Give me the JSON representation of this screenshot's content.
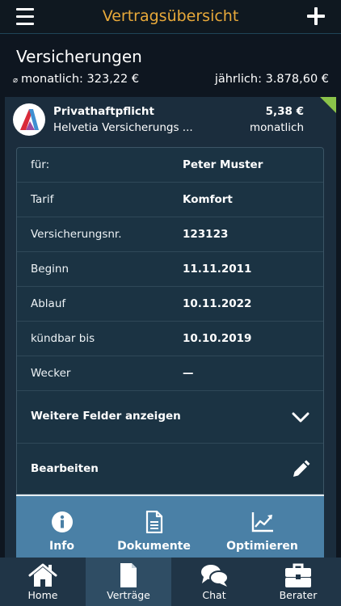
{
  "header": {
    "title": "Vertragsübersicht",
    "menu_icon": "hamburger-menu-icon",
    "add_icon": "plus-icon"
  },
  "section": {
    "title": "Versicherungen",
    "avg_symbol": "⌀",
    "monthly_label": "monatlich:",
    "monthly_value": "323,22 €",
    "yearly_label": "jährlich:",
    "yearly_value": "3.878,60 €"
  },
  "contract": {
    "name": "Privathaftpflicht",
    "company": "Helvetia Versicherungs ...",
    "amount": "5,38 €",
    "period": "monatlich",
    "logo_icon": "helvetia-logo-icon",
    "badge_color": "#8bc34a",
    "fields": [
      {
        "label": "für:",
        "value": "Peter Muster"
      },
      {
        "label": "Tarif",
        "value": "Komfort"
      },
      {
        "label": "Versicherungsnr.",
        "value": "123123"
      },
      {
        "label": "Beginn",
        "value": "11.11.2011"
      },
      {
        "label": "Ablauf",
        "value": "10.11.2022"
      },
      {
        "label": "kündbar bis",
        "value": "10.10.2019"
      },
      {
        "label": "Wecker",
        "value": "—"
      }
    ],
    "more_fields": "Weitere Felder anzeigen",
    "edit": "Bearbeiten",
    "tabs": [
      {
        "label": "Info",
        "icon": "info-icon"
      },
      {
        "label": "Dokumente",
        "icon": "document-icon"
      },
      {
        "label": "Optimieren",
        "icon": "chart-line-icon"
      }
    ]
  },
  "bottom_nav": [
    {
      "label": "Home",
      "icon": "home-icon",
      "active": false
    },
    {
      "label": "Verträge",
      "icon": "file-icon",
      "active": true
    },
    {
      "label": "Chat",
      "icon": "chat-icon",
      "active": false
    },
    {
      "label": "Berater",
      "icon": "briefcase-icon",
      "active": false
    }
  ],
  "colors": {
    "accent": "#e8a93a",
    "background": "#0e1620",
    "card": "#1b2d3d",
    "tab_bar": "#4a80a6"
  }
}
